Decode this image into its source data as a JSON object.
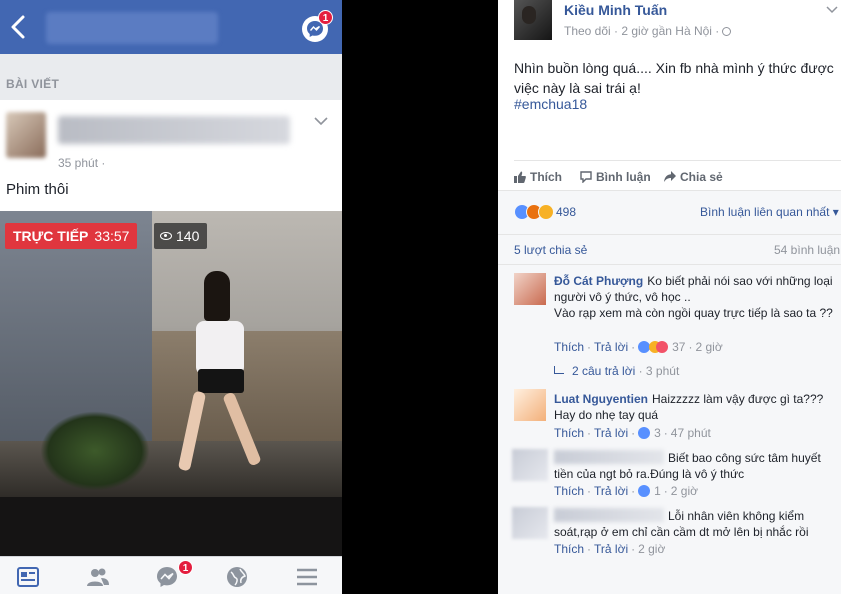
{
  "phone": {
    "section_label": "BÀI VIẾT",
    "post": {
      "time": "35 phút ·",
      "text": "Phim thôi",
      "live_label": "TRỰC TIẾP",
      "live_time": "33:57",
      "viewers": "140"
    },
    "nav_badge": "1",
    "tab_badge": "1",
    "tabs": [
      "news-feed",
      "friends",
      "messenger",
      "notifications",
      "menu"
    ]
  },
  "desktop": {
    "page_name": "Kiều Minh Tuấn",
    "follow": "Theo dõi",
    "meta": " · 2 giờ gần Hà Nội ·",
    "status": "Nhìn buồn lòng quá.... Xin fb nhà mình ý thức được việc này là sai trái ạ!",
    "hashtag": "#emchua18",
    "actions": {
      "like": "Thích",
      "comment": "Bình luận",
      "share": "Chia sẻ"
    },
    "reaction_count": "498",
    "comment_sort": "Bình luận liên quan nhất ▾",
    "shares": "5 lượt chia sẻ",
    "comments_count": "54 bình luận",
    "comments": [
      {
        "author": "Đỗ Cát Phượng",
        "text": "Ko biết phải nói sao với những loại người vô ý thức, vô học ..\nVào rạp xem mà còn ngồi quay trực tiếp là sao ta ??",
        "like": "Thích",
        "reply": "Trả lời",
        "reacts": "37",
        "time": "2 giờ"
      },
      {
        "author": "Luat Nguyentien",
        "text": "Haizzzzz làm vậy được gì ta??? Hay do nhẹ tay quá",
        "like": "Thích",
        "reply": "Trả lời",
        "reacts": "3",
        "time": "47 phút"
      },
      {
        "author": "",
        "text": "Biết bao công sức tâm huyết tiền của ngt bỏ ra.Đúng là vô ý thức",
        "like": "Thích",
        "reply": "Trả lời",
        "reacts": "1",
        "time": "2 giờ"
      },
      {
        "author": "",
        "text": "Lỗi nhân viên không kiểm soát,rạp ở em chỉ cần cầm dt mở lên bị nhắc rồi",
        "like": "Thích",
        "reply": "Trả lời",
        "reacts": "",
        "time": "2 giờ"
      }
    ],
    "replies_link": "2 câu trả lời",
    "replies_time": "· 3 phút"
  },
  "colors": {
    "facebook_blue": "#4267b2",
    "link_blue": "#365899",
    "live_red": "#e0363e",
    "badge_red": "#e41e3f"
  }
}
